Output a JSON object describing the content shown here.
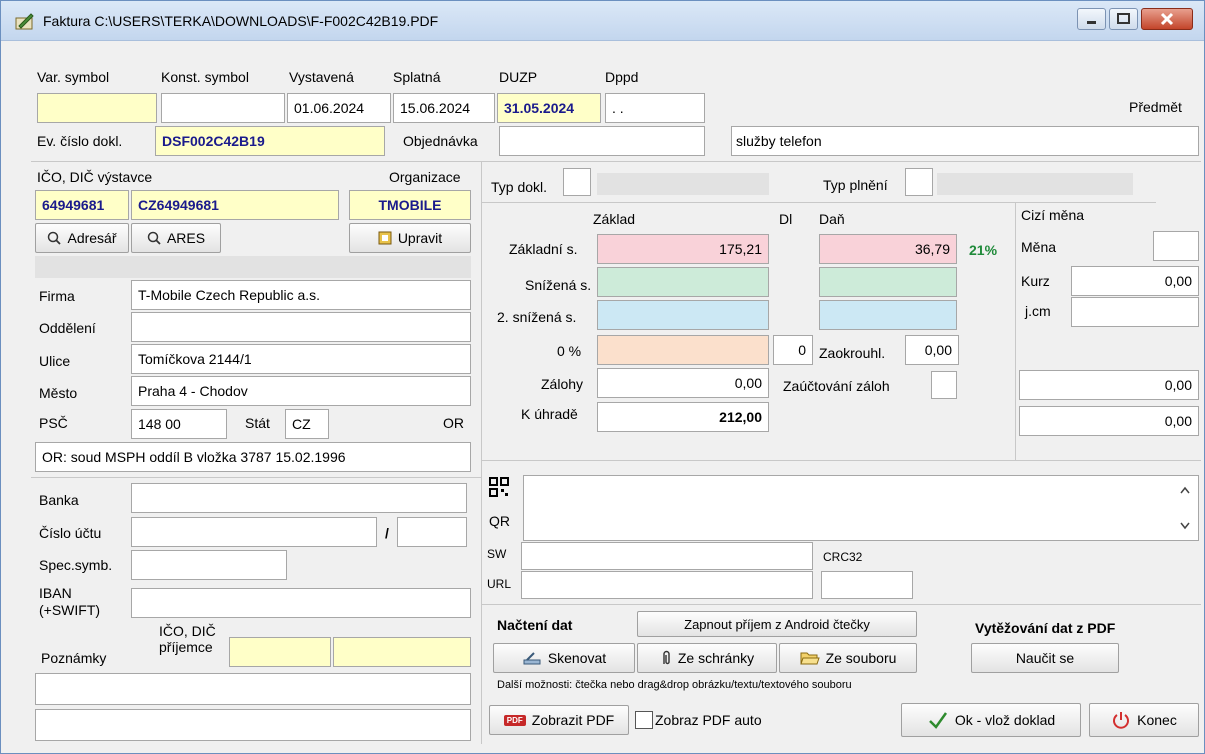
{
  "window": {
    "title": "Faktura C:\\USERS\\TERKA\\DOWNLOADS\\F-F002C42B19.PDF"
  },
  "header": {
    "var_symbol_label": "Var. symbol",
    "var_symbol_value": "",
    "konst_symbol_label": "Konst. symbol",
    "konst_symbol_value": "",
    "vystavena_label": "Vystavená",
    "vystavena_value": "01.06.2024",
    "splatna_label": "Splatná",
    "splatna_value": "15.06.2024",
    "duzp_label": "DUZP",
    "duzp_value": "31.05.2024",
    "dppd_label": "Dppd",
    "dppd_value": ". .",
    "predmet_label": "Předmět",
    "predmet_value": "služby telefon",
    "ev_cislo_label": "Ev. číslo dokl.",
    "ev_cislo_value": "DSF002C42B19",
    "objednavka_label": "Objednávka",
    "objednavka_value": ""
  },
  "supplier": {
    "ico_dic_label": "IČO, DIČ výstavce",
    "organizace_label": "Organizace",
    "ico": "64949681",
    "dic": "CZ64949681",
    "organizace": "TMOBILE",
    "adresar_button": "Adresář",
    "ares_button": "ARES",
    "upravit_button": "Upravit",
    "firma_label": "Firma",
    "firma_value": "T-Mobile Czech Republic a.s.",
    "oddeleni_label": "Oddělení",
    "oddeleni_value": "",
    "ulice_label": "Ulice",
    "ulice_value": "Tomíčkova 2144/1",
    "mesto_label": "Město",
    "mesto_value": "Praha 4 - Chodov",
    "psc_label": "PSČ",
    "psc_value": "148 00",
    "stat_label": "Stát",
    "stat_value": "CZ",
    "or_label": "OR",
    "or_value": "OR: soud MSPH oddíl B vložka 3787 15.02.1996"
  },
  "bank": {
    "banka_label": "Banka",
    "banka_value": "",
    "cislo_uctu_label": "Číslo účtu",
    "cislo_uctu_value": "",
    "slash": "/",
    "kod_banky_value": "",
    "spec_symb_label": "Spec.symb.",
    "spec_symb_value": "",
    "iban_label": "IBAN",
    "swift_label": "(+SWIFT)",
    "iban_value": "",
    "ico_dic_prijemce_label_1": "IČO, DIČ",
    "ico_dic_prijemce_label_2": "příjemce",
    "poznamky_label": "Poznámky",
    "poznamky_1": "",
    "poznamky_2": ""
  },
  "amounts": {
    "typ_dokl_label": "Typ dokl.",
    "typ_plneni_label": "Typ plnění",
    "zaklad_header": "Základ",
    "dl_header": "Dl",
    "dan_header": "Daň",
    "zakladni_label": "Základní s.",
    "zakladni_zaklad": "175,21",
    "zakladni_dan": "36,79",
    "zakladni_rate": "21%",
    "snizena_label": "Snížená s.",
    "snizena2_label": "2. snížená s.",
    "nula_label": "0 %",
    "nula_dl": "0",
    "zaokrouhl_label": "Zaokrouhl.",
    "zaokrouhl_value": "0,00",
    "zalohy_label": "Zálohy",
    "zalohy_value": "0,00",
    "zauctovani_label": "Zaúčtování záloh",
    "k_uhrade_label": "K úhradě",
    "k_uhrade_value": "212,00"
  },
  "foreign": {
    "title": "Cizí měna",
    "mena_label": "Měna",
    "mena_value": "",
    "kurz_label": "Kurz",
    "kurz_value": "0,00",
    "jcm_label": "j.cm",
    "jcm_value": "",
    "zalohy_cm": "0,00",
    "k_uhrade_cm": "0,00"
  },
  "qr": {
    "qr_label": "QR",
    "sw_label": "SW",
    "url_label": "URL",
    "crc32_label": "CRC32"
  },
  "load": {
    "nacteni_label": "Načtení dat",
    "android_button": "Zapnout příjem z Android čtečky",
    "vytezovani_label": "Vytěžování dat z PDF",
    "skenovat_button": "Skenovat",
    "schranka_button": "Ze schránky",
    "soubor_button": "Ze souboru",
    "naucit_button": "Naučit se",
    "dalsi_moznosti": "Další možnosti: čtečka nebo drag&drop obrázku/textu/textového souboru"
  },
  "footer": {
    "pdf_badge": "PDF",
    "zobrazit_pdf_button": "Zobrazit PDF",
    "zobraz_pdf_auto_label": "Zobraz PDF auto",
    "ok_button": "Ok - vlož doklad",
    "konec_button": "Konec"
  },
  "colors": {
    "yellow_field": "#ffffc8",
    "pink_field": "#f9d2d9",
    "green_field": "#cdebd9",
    "blue_field": "#cce8f4",
    "peach_field": "#fbe0cc",
    "navy_text": "#1a1a8c",
    "rate_green": "#1f8a3a"
  }
}
